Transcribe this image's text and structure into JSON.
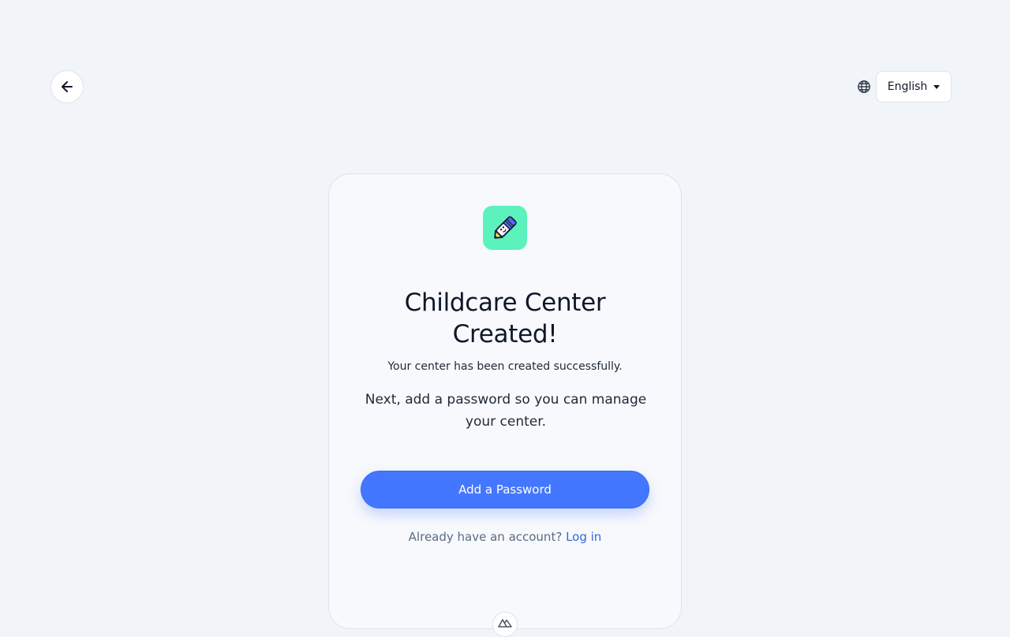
{
  "header": {
    "back_icon": "arrow-left-icon",
    "globe_icon": "globe-icon",
    "language": "English"
  },
  "card": {
    "logo_icon": "pencil-logo-icon",
    "title_line1": "Childcare Center",
    "title_line2": "Created!",
    "subtitle": "Your center has been created successfully.",
    "next_text": "Next, add a password so you can manage your center.",
    "primary_button": "Add a Password",
    "login_prompt": "Already have an account?",
    "login_link": "Log in"
  },
  "colors": {
    "background": "#f1f4f9",
    "card": "#f7f9fc",
    "accent": "#4477ff",
    "logo_bg": "#5cf2bd",
    "link": "#2f6bdc"
  }
}
